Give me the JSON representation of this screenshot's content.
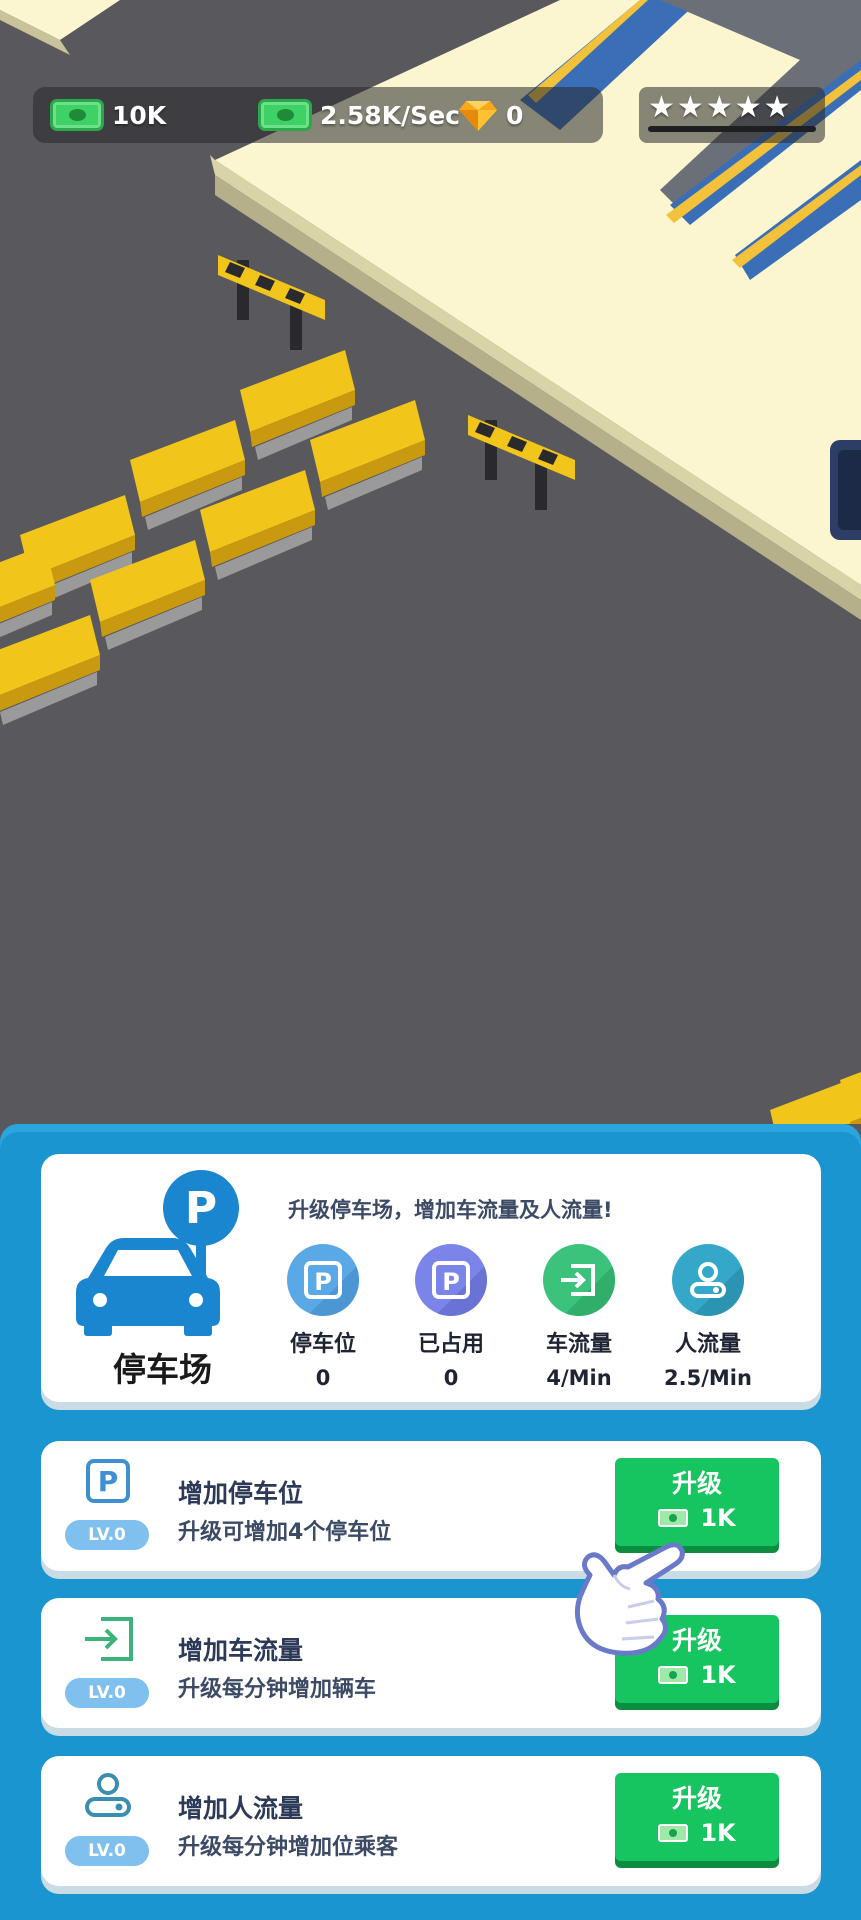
{
  "hud": {
    "cash": "10K",
    "income_rate": "2.58K/Sec",
    "gems": "0",
    "stars": [
      "★",
      "★",
      "★",
      "★",
      "★"
    ]
  },
  "parking": {
    "title": "停车场",
    "description": "升级停车场，增加车流量及人流量!",
    "stats": [
      {
        "label": "停车位",
        "value": "0",
        "color": "#5aa9e6",
        "icon": "parking-icon"
      },
      {
        "label": "已占用",
        "value": "0",
        "color": "#7b84e8",
        "icon": "parking-occupied-icon"
      },
      {
        "label": "车流量",
        "value": "4/Min",
        "color": "#3cc37b",
        "icon": "car-flow-icon"
      },
      {
        "label": "人流量",
        "value": "2.5/Min",
        "color": "#35a8c9",
        "icon": "people-flow-icon"
      }
    ]
  },
  "upgrades": [
    {
      "title": "增加停车位",
      "desc": "升级可增加4个停车位",
      "level": "LV.0",
      "button": "升级",
      "cost": "1K",
      "icon": "parking-icon"
    },
    {
      "title": "增加车流量",
      "desc": "升级每分钟增加辆车",
      "level": "LV.0",
      "button": "升级",
      "cost": "1K",
      "icon": "enter-icon"
    },
    {
      "title": "增加人流量",
      "desc": "升级每分钟增加位乘客",
      "level": "LV.0",
      "button": "升级",
      "cost": "1K",
      "icon": "person-icon"
    }
  ],
  "colors": {
    "panel": "#1a95cf",
    "button": "#17c560",
    "barrier": "#f2c51a"
  }
}
